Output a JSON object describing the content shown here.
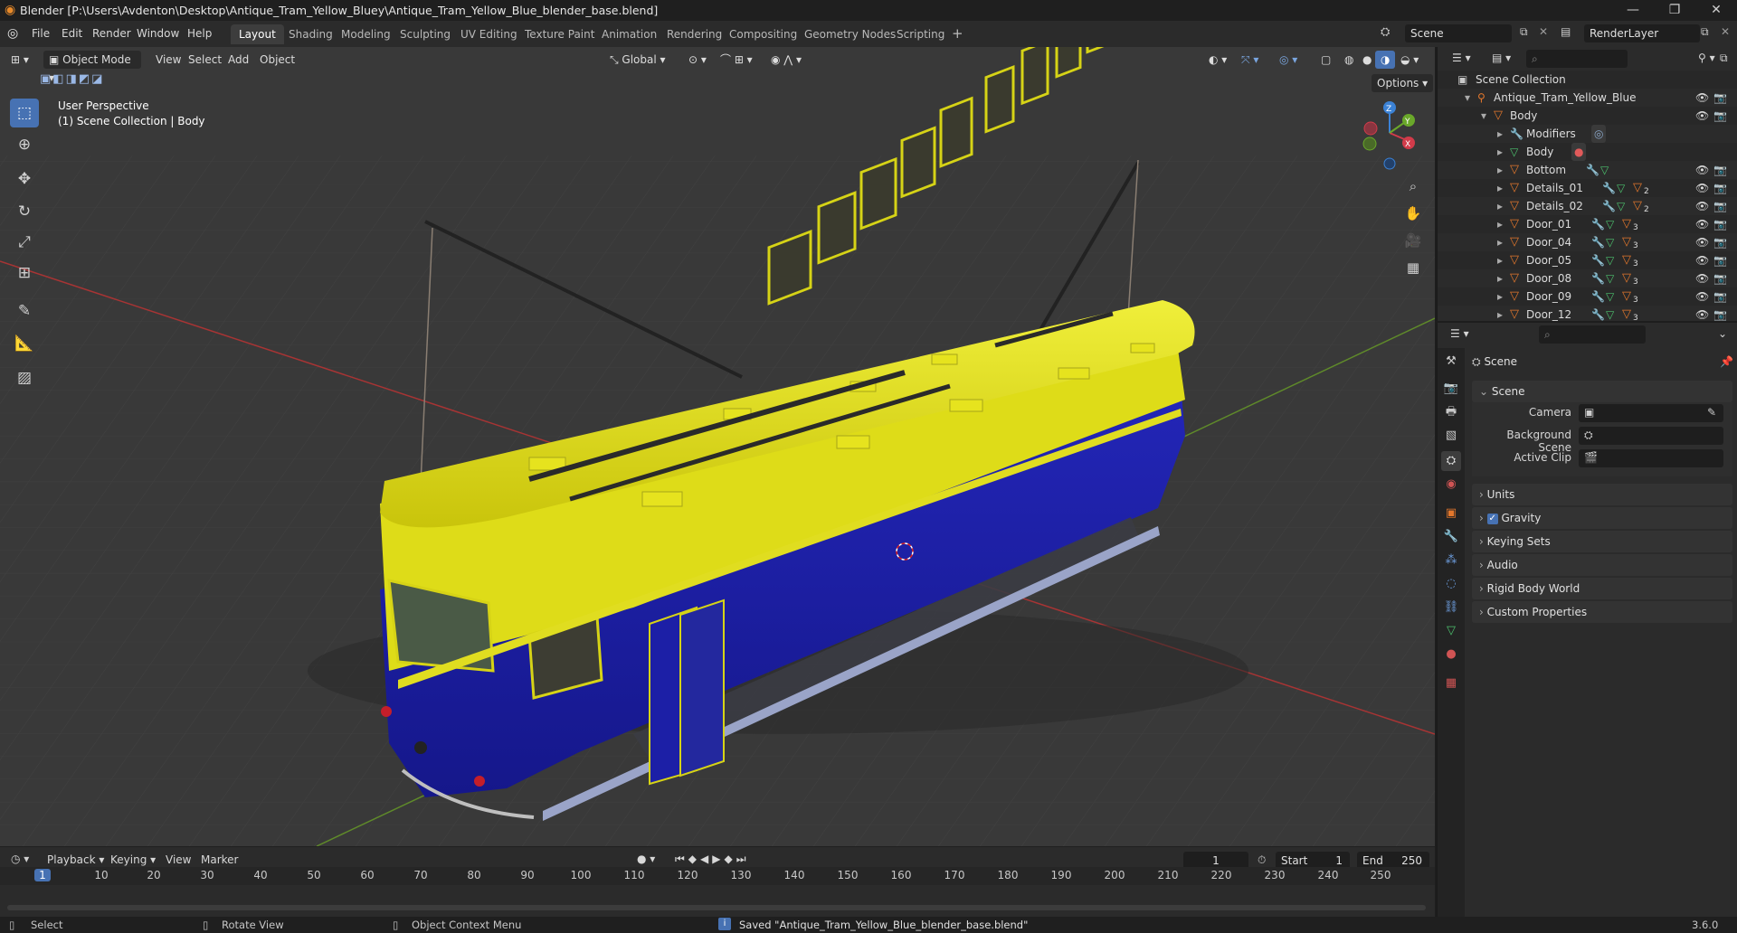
{
  "titlebar": {
    "title": "Blender [P:\\Users\\Avdenton\\Desktop\\Antique_Tram_Yellow_Bluey\\Antique_Tram_Yellow_Blue_blender_base.blend]",
    "minimize": "—",
    "maximize": "❐",
    "close": "✕"
  },
  "menu": {
    "file": "File",
    "edit": "Edit",
    "render": "Render",
    "window": "Window",
    "help": "Help"
  },
  "workspaces": [
    "Layout",
    "Shading",
    "Modeling",
    "Sculpting",
    "UV Editing",
    "Texture Paint",
    "Animation",
    "Rendering",
    "Compositing",
    "Geometry Nodes",
    "Scripting"
  ],
  "workspace_add": "+",
  "scene": {
    "name": "Scene",
    "view_layer": "RenderLayer"
  },
  "viewport": {
    "mode": "Object Mode",
    "menus": [
      "View",
      "Select",
      "Add",
      "Object"
    ],
    "transform_orientation": "Global",
    "options": "Options",
    "info_line1": "User Perspective",
    "info_line2": "(1) Scene Collection | Body",
    "gizmo": {
      "x": "X",
      "y": "Y",
      "z": "Z"
    }
  },
  "timeline": {
    "menus": [
      "Playback",
      "Keying",
      "View",
      "Marker"
    ],
    "current_frame": "1",
    "start_label": "Start",
    "start": "1",
    "end_label": "End",
    "end": "250",
    "ticks": [
      "1",
      "10",
      "20",
      "30",
      "40",
      "50",
      "60",
      "70",
      "80",
      "90",
      "100",
      "110",
      "120",
      "130",
      "140",
      "150",
      "160",
      "170",
      "180",
      "190",
      "200",
      "210",
      "220",
      "230",
      "240",
      "250"
    ]
  },
  "statusbar": {
    "select": "Select",
    "rotate": "Rotate View",
    "context": "Object Context Menu",
    "message": "Saved \"Antique_Tram_Yellow_Blue_blender_base.blend\"",
    "version": "3.6.0"
  },
  "outliner": {
    "root": "Scene Collection",
    "collection": "Antique_Tram_Yellow_Blue",
    "rows": [
      {
        "name": "Body",
        "level": 1,
        "badge": ""
      },
      {
        "name": "Modifiers",
        "level": 2,
        "badge": ""
      },
      {
        "name": "Body",
        "level": 2,
        "badge": ""
      },
      {
        "name": "Bottom",
        "level": 2,
        "badge": ""
      },
      {
        "name": "Details_01",
        "level": 2,
        "badge": "2"
      },
      {
        "name": "Details_02",
        "level": 2,
        "badge": "2"
      },
      {
        "name": "Door_01",
        "level": 2,
        "badge": "3"
      },
      {
        "name": "Door_04",
        "level": 2,
        "badge": "3"
      },
      {
        "name": "Door_05",
        "level": 2,
        "badge": "3"
      },
      {
        "name": "Door_08",
        "level": 2,
        "badge": "3"
      },
      {
        "name": "Door_09",
        "level": 2,
        "badge": "3"
      },
      {
        "name": "Door_12",
        "level": 2,
        "badge": "3"
      }
    ]
  },
  "properties": {
    "context": "Scene",
    "section": "Scene",
    "fields": [
      {
        "label": "Camera",
        "value": ""
      },
      {
        "label": "Background Scene",
        "value": ""
      },
      {
        "label": "Active Clip",
        "value": ""
      }
    ],
    "panels": [
      "Units",
      "Gravity",
      "Keying Sets",
      "Audio",
      "Rigid Body World",
      "Custom Properties"
    ]
  },
  "colors": {
    "accent": "#4772b3",
    "tram_yellow": "#e4e212",
    "tram_blue": "#1c1fa6",
    "axis_red": "#b23a3a",
    "axis_green": "#6a9a2a"
  }
}
